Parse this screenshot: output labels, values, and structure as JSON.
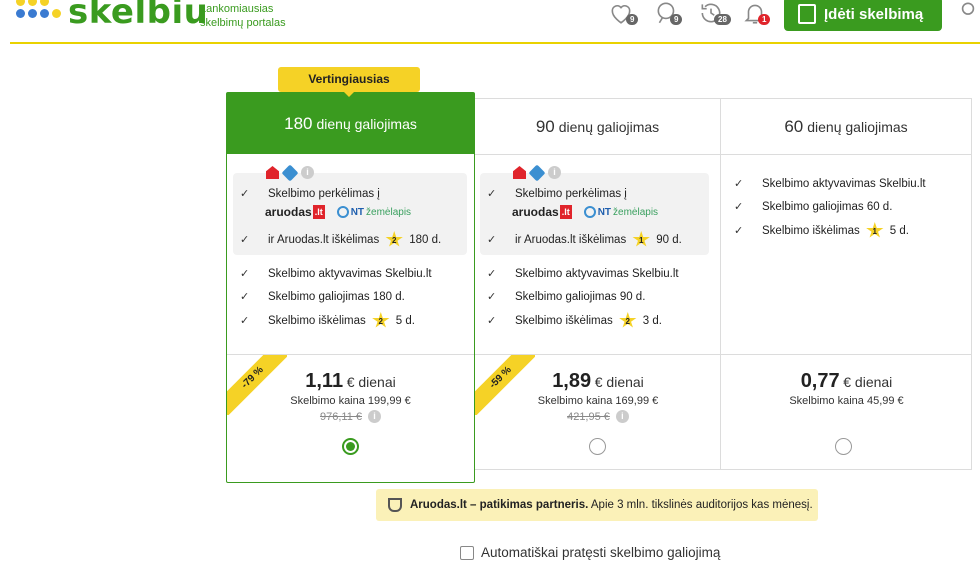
{
  "header": {
    "brand": "skelbiu",
    "tagline_1": "Lankomiausias",
    "tagline_2": "skelbimų portalas",
    "favorites_count": "9",
    "searches_count": "9",
    "history_count": "28",
    "notifications_count": "1",
    "add_button": "Įdėti skelbimą",
    "colors": {
      "brand": "#3a9b1f",
      "accent": "#f5d226"
    }
  },
  "plans": [
    {
      "days": "180",
      "title_suffix": "dienų galiojimas",
      "badge": "Vertingiausias",
      "promo_transfer": "Skelbimo perkėlimas į",
      "promo_highlight_prefix": "ir Aruodas.lt iškėlimas",
      "promo_highlight_star": "2",
      "promo_highlight_days": "180 d.",
      "feat_activate": "Skelbimo aktyvavimas Skelbiu.lt",
      "feat_validity": "Skelbimo galiojimas 180 d.",
      "feat_raise_prefix": "Skelbimo iškėlimas",
      "feat_raise_star": "2",
      "feat_raise_days": "5 d.",
      "discount": "-79 %",
      "price_value": "1,11",
      "price_unit": "€ dienai",
      "price_total": "Skelbimo kaina 199,99 €",
      "price_old": "976,11 €",
      "selected": true
    },
    {
      "days": "90",
      "title_suffix": "dienų galiojimas",
      "promo_transfer": "Skelbimo perkėlimas į",
      "promo_highlight_prefix": "ir Aruodas.lt iškėlimas",
      "promo_highlight_star": "1",
      "promo_highlight_days": "90 d.",
      "feat_activate": "Skelbimo aktyvavimas Skelbiu.lt",
      "feat_validity": "Skelbimo galiojimas 90 d.",
      "feat_raise_prefix": "Skelbimo iškėlimas",
      "feat_raise_star": "2",
      "feat_raise_days": "3 d.",
      "discount": "-59 %",
      "price_value": "1,89",
      "price_unit": "€ dienai",
      "price_total": "Skelbimo kaina 169,99 €",
      "price_old": "421,95 €",
      "selected": false
    },
    {
      "days": "60",
      "title_suffix": "dienų galiojimas",
      "feat_activate": "Skelbimo aktyvavimas Skelbiu.lt",
      "feat_validity": "Skelbimo galiojimas 60 d.",
      "feat_raise_prefix": "Skelbimo iškėlimas",
      "feat_raise_star": "1",
      "feat_raise_days": "5 d.",
      "price_value": "0,77",
      "price_unit": "€ dienai",
      "price_total": "Skelbimo kaina 45,99 €",
      "selected": false
    }
  ],
  "partner_logos": {
    "aruodas": "aruodas",
    "aruodas_tld": ".lt",
    "nt_prefix": "NT",
    "nt_name": "žemėlapis"
  },
  "partner_note": {
    "bold": "Aruodas.lt – patikimas partneris.",
    "text": "Apie 3 mln. tikslinės auditorijos kas mėnesį."
  },
  "auto_renew_label": "Automatiškai pratęsti skelbimo galiojimą",
  "check_glyph": "✓",
  "info_glyph": "i"
}
